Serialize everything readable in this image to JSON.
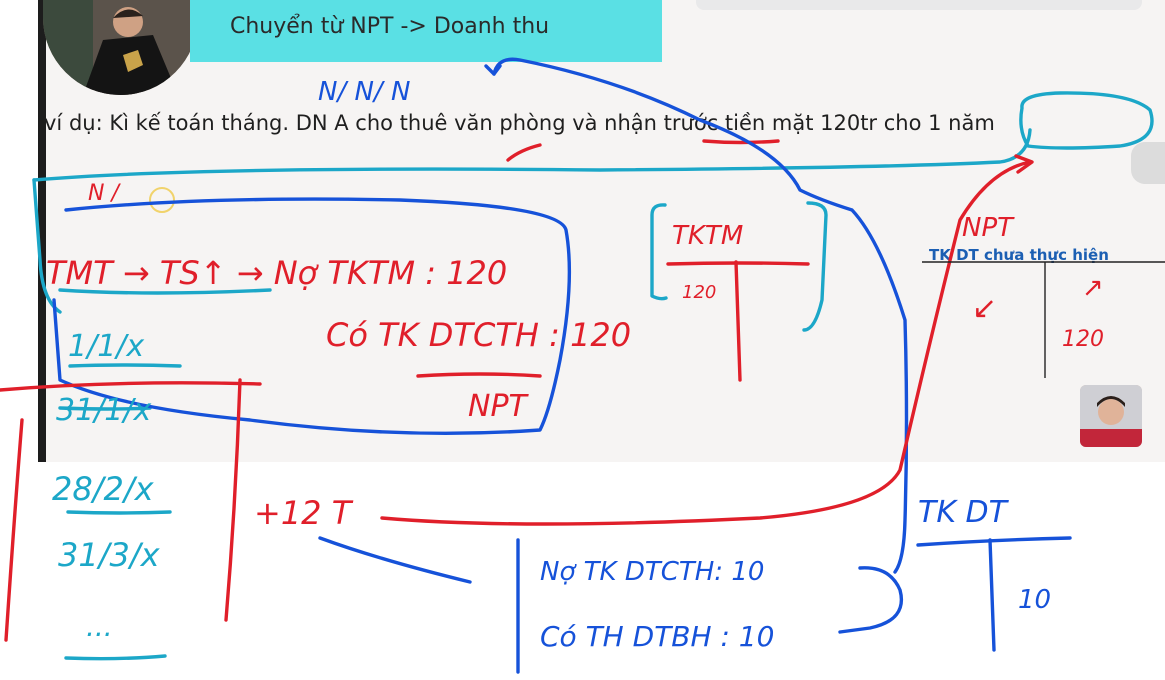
{
  "slide": {
    "title": "Chuyển từ NPT -> Doanh thu",
    "example": "ví dụ: Kì kế toán tháng. DN A cho thuê văn phòng và nhận trước tiền mặt 120tr cho 1 năm",
    "tk_dt_header": "TK DT chưa thực hiện"
  },
  "annotations": {
    "n_marks": "N/ N/ N",
    "n_corner": "N /",
    "formula_top": "TMT → TS↑ → Nợ TKTM : 120",
    "formula_co": "Có TK DTCTH : 120",
    "npt_under": "NPT",
    "tktm_label": "TKTM",
    "tktm_value": "120",
    "npt_right": "NPT",
    "tk_dt_left": "↙",
    "tk_dt_right_sign": "↗",
    "tk_dt_right_value": "120",
    "dates": [
      "1/1/x",
      "31/1/x",
      "28/2/x",
      "31/3/x",
      "..."
    ],
    "plus_12t": "+12 T",
    "no_line": "Nợ TK DTCTH: 10",
    "co_line": "Có TH DTBH : 10",
    "tk_dt_label": "TK DT",
    "tk_dt_value": "10"
  },
  "colors": {
    "title_bg": "#5ae0e4",
    "ink_blue": "#1652d9",
    "ink_red": "#e01f2a",
    "ink_cyan": "#1ca7c8",
    "header_blue": "#1c5fb3"
  }
}
